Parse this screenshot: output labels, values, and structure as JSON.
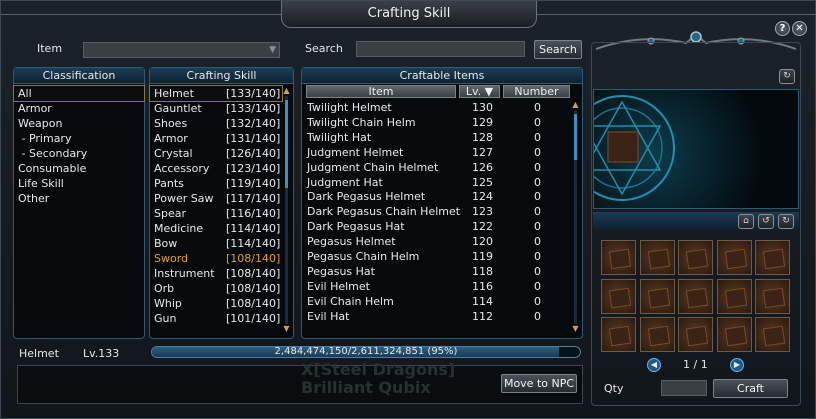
{
  "window": {
    "title": "Crafting Skill",
    "help_label": "?",
    "close_label": "✕"
  },
  "filter": {
    "item_label": "Item",
    "item_value": "",
    "search_label": "Search",
    "search_value": "",
    "search_button": "Search"
  },
  "classification": {
    "header": "Classification",
    "items": [
      "All",
      "Armor",
      "Weapon",
      " - Primary",
      " - Secondary",
      "Consumable",
      "Life Skill",
      "Other"
    ],
    "selected_index": 0
  },
  "crafting_skill": {
    "header": "Crafting Skill",
    "items": [
      {
        "name": "Helmet",
        "value": "[133/140]"
      },
      {
        "name": "Gauntlet",
        "value": "[133/140]"
      },
      {
        "name": "Shoes",
        "value": "[132/140]"
      },
      {
        "name": "Armor",
        "value": "[131/140]"
      },
      {
        "name": "Crystal",
        "value": "[126/140]"
      },
      {
        "name": "Accessory",
        "value": "[123/140]"
      },
      {
        "name": "Pants",
        "value": "[119/140]"
      },
      {
        "name": "Power Saw",
        "value": "[117/140]"
      },
      {
        "name": "Spear",
        "value": "[116/140]"
      },
      {
        "name": "Medicine",
        "value": "[114/140]"
      },
      {
        "name": "Bow",
        "value": "[114/140]"
      },
      {
        "name": "Sword",
        "value": "[108/140]"
      },
      {
        "name": "Instrument",
        "value": "[108/140]"
      },
      {
        "name": "Orb",
        "value": "[108/140]"
      },
      {
        "name": "Whip",
        "value": "[108/140]"
      },
      {
        "name": "Gun",
        "value": "[101/140]"
      }
    ],
    "selected_index": 0,
    "highlight_index": 11,
    "highlight_color": "#e0a020"
  },
  "craftable_items": {
    "header": "Craftable Items",
    "columns": [
      "Item",
      "Lv. ▼",
      "Number"
    ],
    "rows": [
      {
        "item": "Twilight Helmet",
        "lv": "130",
        "number": "0"
      },
      {
        "item": "Twilight Chain Helm",
        "lv": "129",
        "number": "0"
      },
      {
        "item": "Twilight Hat",
        "lv": "128",
        "number": "0"
      },
      {
        "item": "Judgment Helmet",
        "lv": "127",
        "number": "0"
      },
      {
        "item": "Judgment Chain Helmet",
        "lv": "126",
        "number": "0"
      },
      {
        "item": "Judgment Hat",
        "lv": "125",
        "number": "0"
      },
      {
        "item": "Dark Pegasus Helmet",
        "lv": "124",
        "number": "0"
      },
      {
        "item": "Dark Pegasus Chain Helmet",
        "lv": "123",
        "number": "0"
      },
      {
        "item": "Dark Pegasus Hat",
        "lv": "122",
        "number": "0"
      },
      {
        "item": "Pegasus Helmet",
        "lv": "120",
        "number": "0"
      },
      {
        "item": "Pegasus Chain Helm",
        "lv": "119",
        "number": "0"
      },
      {
        "item": "Pegasus Hat",
        "lv": "118",
        "number": "0"
      },
      {
        "item": "Evil Helmet",
        "lv": "116",
        "number": "0"
      },
      {
        "item": "Evil Chain Helm",
        "lv": "114",
        "number": "0"
      },
      {
        "item": "Evil Hat",
        "lv": "112",
        "number": "0"
      }
    ]
  },
  "status": {
    "skill_name": "Helmet",
    "level": "Lv.133",
    "exp_text": "2,484,474,150/2,611,324,851 (95%)",
    "exp_percent": 95
  },
  "actions": {
    "move_to_npc": "Move to NPC",
    "qty_label": "Qty",
    "qty_value": "",
    "craft": "Craft"
  },
  "materials": {
    "page": "1 / 1",
    "slot_count": 15
  },
  "watermark": {
    "line1": "X[Steel Dragons]",
    "line2": "Brilliant Qubix"
  },
  "colors": {
    "panel_border": "#2c5a78",
    "header_blue": "#1b3e58",
    "highlight_gold": "#e0a020",
    "accent": "#3d8fbf"
  }
}
